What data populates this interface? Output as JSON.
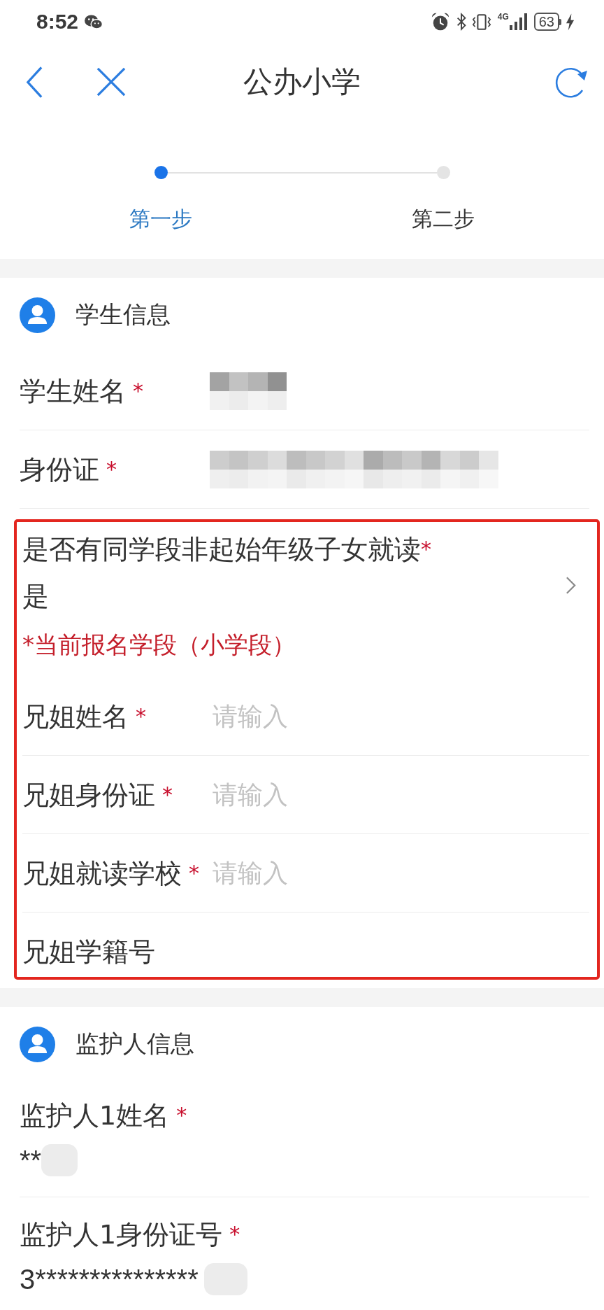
{
  "status_bar": {
    "time": "8:52",
    "network": "4G",
    "battery": "63"
  },
  "nav_bar": {
    "title": "公办小学"
  },
  "steps": [
    {
      "label": "第一步",
      "selected": true
    },
    {
      "label": "第二步",
      "selected": false
    }
  ],
  "sections": [
    {
      "title": "学生信息",
      "fields": [
        {
          "kind": "masked",
          "label": "学生姓名",
          "required_mark": "*"
        },
        {
          "kind": "masked",
          "label": "身份证",
          "required_mark": "*"
        }
      ],
      "highlight_group": {
        "highlighted": true,
        "fields": [
          {
            "kind": "select",
            "label": "是否有同学段非起始年级子女就读",
            "required_mark": "*",
            "value": "是"
          },
          {
            "kind": "note",
            "text": "*当前报名学段（小学段）"
          },
          {
            "kind": "input",
            "label": "兄姐姓名",
            "required_mark": "*",
            "placeholder": "请输入"
          },
          {
            "kind": "input",
            "label": "兄姐身份证",
            "required_mark": "*",
            "placeholder": "请输入"
          },
          {
            "kind": "input",
            "label": "兄姐就读学校",
            "required_mark": "*",
            "placeholder": "请输入"
          },
          {
            "kind": "input",
            "label": "兄姐学籍号"
          }
        ]
      }
    },
    {
      "title": "监护人信息",
      "fields": [
        {
          "kind": "stacked",
          "label": "监护人1姓名",
          "required_mark": "*",
          "value": "**",
          "value_obscured": true
        },
        {
          "kind": "stacked",
          "label": "监护人1身份证号",
          "required_mark": "*",
          "value": "3***************",
          "value_obscured": true
        }
      ]
    }
  ]
}
